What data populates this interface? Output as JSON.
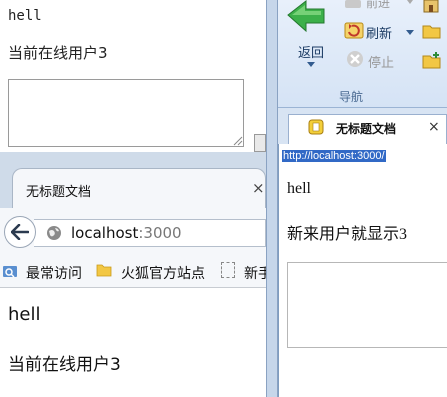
{
  "win1": {
    "heading": "hell",
    "status": "当前在线用户3",
    "textarea_value": ""
  },
  "firefox": {
    "tab_title": "无标题文档",
    "tab_close": "×",
    "url_host": "localhost",
    "url_port": ":3000",
    "bookmarks": [
      {
        "label": "最常访问",
        "icon": "star-folder-icon"
      },
      {
        "label": "火狐官方站点",
        "icon": "folder-icon"
      },
      {
        "label": "新手",
        "icon": "blank-page-icon"
      }
    ],
    "content_heading": "hell",
    "content_status": "当前在线用户3"
  },
  "ie": {
    "back_label": "返回",
    "forward_label": "前进",
    "refresh_label": "刷新",
    "stop_label": "停止",
    "group_label": "导航",
    "tab_title": "无标题文档",
    "tab_close": "×",
    "url": "http://localhost:3000/",
    "content_heading": "hell",
    "content_status": "新来用户就显示3",
    "textarea_value": ""
  },
  "colors": {
    "ribbon_text": "#1a3a63",
    "selection": "#3169c6",
    "back_arrow": "#3cb04a"
  }
}
